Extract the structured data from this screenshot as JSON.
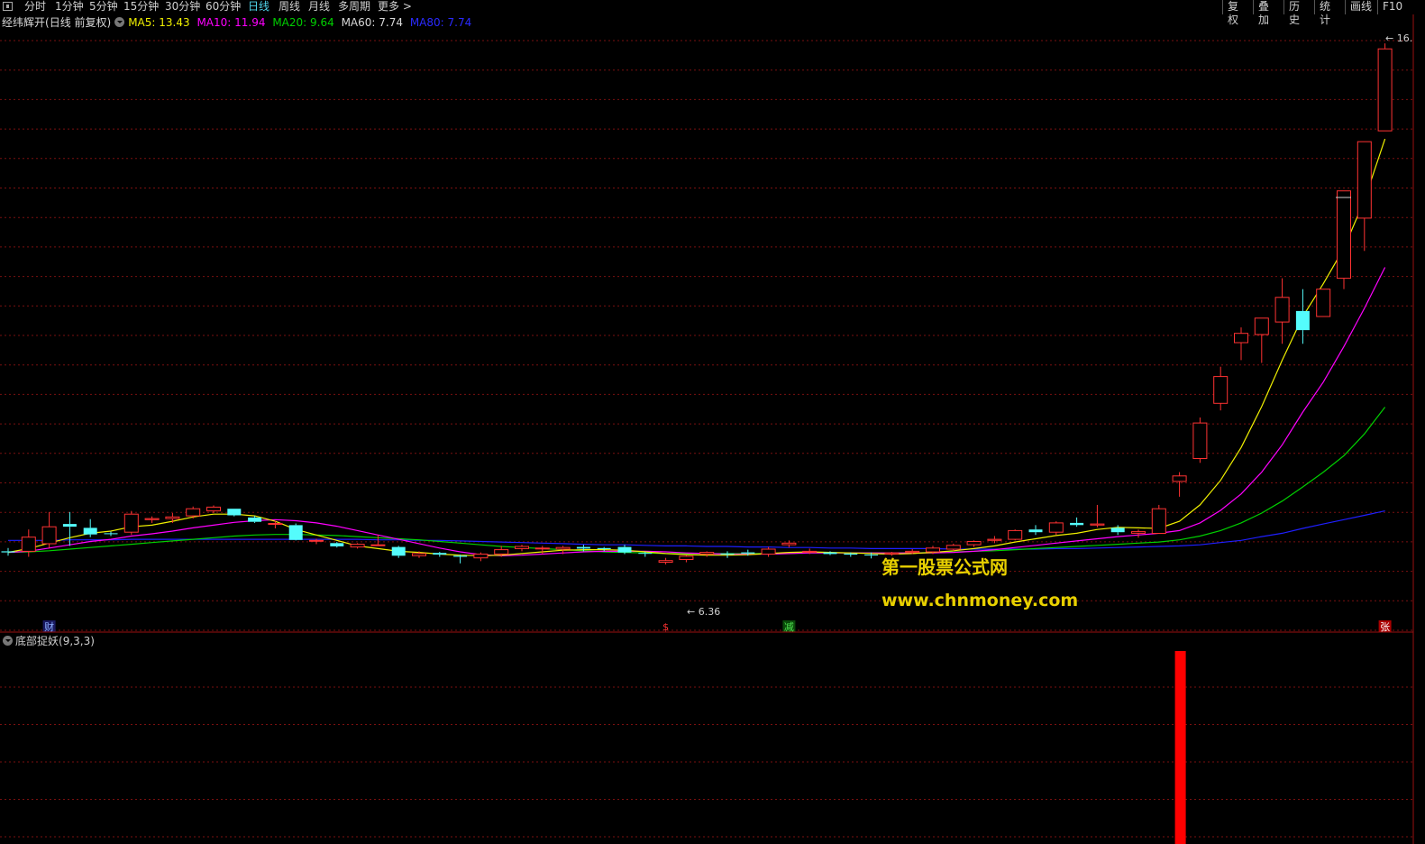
{
  "toolbar": {
    "periods": [
      "分时",
      "1分钟",
      "5分钟",
      "15分钟",
      "30分钟",
      "60分钟",
      "日线",
      "周线",
      "月线",
      "多周期",
      "更多 >"
    ],
    "active_period": "日线",
    "right_buttons": [
      "复权",
      "叠加",
      "历史",
      "统计",
      "画线",
      "F10"
    ]
  },
  "legend": {
    "title": "经纬辉开",
    "subtitle": "(日线 前复权)",
    "ma5": "MA5: 13.43",
    "ma10": "MA10: 11.94",
    "ma20": "MA20: 9.64",
    "ma60": "MA60: 7.74",
    "ma80": "MA80: 7.74"
  },
  "colors": {
    "up": "#ff3232",
    "down": "#54fcfc",
    "ma5": "#f0f000",
    "ma10": "#ff00ff",
    "ma20": "#00d000",
    "ma60": "#1f1fff",
    "grid": "#7a1010",
    "signal": "#ff0000",
    "watermark": "#e8d000"
  },
  "watermark": {
    "line1": "第一股票公式网",
    "line2": "www.chnmoney.com"
  },
  "annotations": {
    "high_label": "16.",
    "low_label": "6.36"
  },
  "markers": [
    {
      "label": "财",
      "color": "#8fb0ff",
      "bg": "#1a1a60",
      "index": 2
    },
    {
      "label": "$",
      "color": "#ff3232",
      "bg": "",
      "index": 32
    },
    {
      "label": "减",
      "color": "#50e050",
      "bg": "#0a4a0a",
      "index": 38
    },
    {
      "label": "张",
      "color": "#ffffff",
      "bg": "#aa0000",
      "index": 67
    }
  ],
  "indicator": {
    "name": "底部捉妖",
    "params": "(9,3,3)"
  },
  "chart_data": {
    "type": "candlestick",
    "title": "经纬辉开 (日线 前复权)",
    "ylim": [
      6.0,
      16.5
    ],
    "candles": [
      [
        7.0,
        7.06,
        6.92,
        6.98
      ],
      [
        7.0,
        7.4,
        6.9,
        7.26
      ],
      [
        7.14,
        7.72,
        7.06,
        7.45
      ],
      [
        7.5,
        7.72,
        7.1,
        7.45
      ],
      [
        7.43,
        7.59,
        7.26,
        7.31
      ],
      [
        7.33,
        7.36,
        7.28,
        7.32
      ],
      [
        7.35,
        7.74,
        7.3,
        7.68
      ],
      [
        7.58,
        7.64,
        7.52,
        7.6
      ],
      [
        7.6,
        7.7,
        7.52,
        7.63
      ],
      [
        7.65,
        7.82,
        7.6,
        7.78
      ],
      [
        7.74,
        7.84,
        7.7,
        7.81
      ],
      [
        7.78,
        7.78,
        7.64,
        7.66
      ],
      [
        7.62,
        7.65,
        7.52,
        7.54
      ],
      [
        7.5,
        7.56,
        7.42,
        7.51
      ],
      [
        7.48,
        7.51,
        7.2,
        7.21
      ],
      [
        7.2,
        7.23,
        7.13,
        7.2
      ],
      [
        7.15,
        7.17,
        7.07,
        7.09
      ],
      [
        7.08,
        7.15,
        7.05,
        7.13
      ],
      [
        7.12,
        7.3,
        7.1,
        7.12
      ],
      [
        7.08,
        7.1,
        6.88,
        6.92
      ],
      [
        6.92,
        7.0,
        6.88,
        6.96
      ],
      [
        6.97,
        6.99,
        6.9,
        6.94
      ],
      [
        6.92,
        6.94,
        6.78,
        6.9
      ],
      [
        6.88,
        6.98,
        6.82,
        6.95
      ],
      [
        6.95,
        7.1,
        6.9,
        7.03
      ],
      [
        7.05,
        7.12,
        7.0,
        7.09
      ],
      [
        7.05,
        7.1,
        6.95,
        7.06
      ],
      [
        7.04,
        7.1,
        6.95,
        7.07
      ],
      [
        7.08,
        7.12,
        7.0,
        7.05
      ],
      [
        7.06,
        7.08,
        7.0,
        7.04
      ],
      [
        7.08,
        7.12,
        6.95,
        6.98
      ],
      [
        6.97,
        6.99,
        6.9,
        6.96
      ],
      [
        6.8,
        6.88,
        6.76,
        6.83
      ],
      [
        6.85,
        6.93,
        6.8,
        6.91
      ],
      [
        6.95,
        7.0,
        6.9,
        6.98
      ],
      [
        6.96,
        7.0,
        6.88,
        6.95
      ],
      [
        6.98,
        7.03,
        6.92,
        6.96
      ],
      [
        6.95,
        7.08,
        6.9,
        7.04
      ],
      [
        7.12,
        7.2,
        7.07,
        7.15
      ],
      [
        7.0,
        7.05,
        6.95,
        7.0
      ],
      [
        6.98,
        7.0,
        6.93,
        6.95
      ],
      [
        6.96,
        6.98,
        6.9,
        6.94
      ],
      [
        6.94,
        6.98,
        6.87,
        6.93
      ],
      [
        6.95,
        6.99,
        6.92,
        6.97
      ],
      [
        6.98,
        7.04,
        6.95,
        7.0
      ],
      [
        6.99,
        7.1,
        6.95,
        7.06
      ],
      [
        7.04,
        7.14,
        7.0,
        7.11
      ],
      [
        7.12,
        7.2,
        7.08,
        7.18
      ],
      [
        7.2,
        7.28,
        7.15,
        7.22
      ],
      [
        7.22,
        7.4,
        7.2,
        7.38
      ],
      [
        7.4,
        7.48,
        7.3,
        7.35
      ],
      [
        7.35,
        7.55,
        7.3,
        7.52
      ],
      [
        7.52,
        7.62,
        7.45,
        7.48
      ],
      [
        7.48,
        7.85,
        7.44,
        7.5
      ],
      [
        7.43,
        7.48,
        7.3,
        7.35
      ],
      [
        7.33,
        7.4,
        7.25,
        7.36
      ],
      [
        7.33,
        7.85,
        7.32,
        7.78
      ],
      [
        8.28,
        8.45,
        8.0,
        8.38
      ],
      [
        8.7,
        9.45,
        8.62,
        9.35
      ],
      [
        9.71,
        10.38,
        9.58,
        10.2
      ],
      [
        10.82,
        11.1,
        10.5,
        10.99
      ],
      [
        10.97,
        11.2,
        10.45,
        11.27
      ],
      [
        11.2,
        12.0,
        10.8,
        11.65
      ],
      [
        11.4,
        11.8,
        10.8,
        11.05
      ],
      [
        11.3,
        11.8,
        11.3,
        11.8
      ],
      [
        12.0,
        13.2,
        11.8,
        13.6
      ],
      [
        13.1,
        14.2,
        12.5,
        14.5
      ],
      [
        14.7,
        16.3,
        14.7,
        16.2
      ]
    ],
    "ma5": [
      6.98,
      7.05,
      7.15,
      7.25,
      7.33,
      7.37,
      7.45,
      7.48,
      7.55,
      7.63,
      7.68,
      7.68,
      7.65,
      7.55,
      7.4,
      7.3,
      7.2,
      7.1,
      7.05,
      7.0,
      6.98,
      6.95,
      6.93,
      6.92,
      6.93,
      6.96,
      6.99,
      7.02,
      7.03,
      7.03,
      7.02,
      6.99,
      6.96,
      6.94,
      6.93,
      6.93,
      6.94,
      6.96,
      6.98,
      6.99,
      6.98,
      6.97,
      6.96,
      6.95,
      6.96,
      6.98,
      7.01,
      7.05,
      7.1,
      7.17,
      7.23,
      7.29,
      7.33,
      7.4,
      7.44,
      7.43,
      7.42,
      7.55,
      7.85,
      8.3,
      8.9,
      9.65,
      10.5,
      11.3,
      11.9,
      12.55,
      13.43,
      14.55
    ],
    "ma10": [
      6.98,
      7.0,
      7.06,
      7.12,
      7.18,
      7.22,
      7.28,
      7.32,
      7.37,
      7.43,
      7.48,
      7.53,
      7.56,
      7.58,
      7.56,
      7.52,
      7.46,
      7.38,
      7.3,
      7.22,
      7.14,
      7.06,
      6.99,
      6.94,
      6.92,
      6.93,
      6.95,
      6.97,
      6.99,
      7.0,
      7.0,
      7.0,
      6.99,
      6.97,
      6.96,
      6.95,
      6.95,
      6.95,
      6.96,
      6.97,
      6.97,
      6.97,
      6.97,
      6.97,
      6.97,
      6.97,
      6.98,
      7.0,
      7.03,
      7.07,
      7.11,
      7.15,
      7.19,
      7.23,
      7.27,
      7.3,
      7.33,
      7.38,
      7.52,
      7.75,
      8.05,
      8.45,
      8.95,
      9.55,
      10.1,
      10.75,
      11.45,
      12.2
    ],
    "ma20": [
      6.98,
      6.99,
      7.01,
      7.04,
      7.07,
      7.1,
      7.13,
      7.16,
      7.19,
      7.22,
      7.25,
      7.28,
      7.3,
      7.31,
      7.31,
      7.3,
      7.29,
      7.27,
      7.25,
      7.23,
      7.21,
      7.18,
      7.15,
      7.12,
      7.09,
      7.07,
      7.05,
      7.03,
      7.01,
      6.99,
      6.98,
      6.97,
      6.96,
      6.96,
      6.96,
      6.96,
      6.96,
      6.96,
      6.96,
      6.97,
      6.97,
      6.97,
      6.97,
      6.97,
      6.97,
      6.98,
      6.99,
      7.0,
      7.01,
      7.03,
      7.05,
      7.07,
      7.09,
      7.11,
      7.13,
      7.15,
      7.17,
      7.21,
      7.28,
      7.38,
      7.52,
      7.7,
      7.92,
      8.18,
      8.45,
      8.75,
      9.15,
      9.64
    ],
    "ma60": [
      7.2,
      7.2,
      7.2,
      7.21,
      7.21,
      7.21,
      7.22,
      7.22,
      7.22,
      7.22,
      7.22,
      7.22,
      7.22,
      7.22,
      7.22,
      7.22,
      7.22,
      7.22,
      7.21,
      7.21,
      7.2,
      7.2,
      7.19,
      7.18,
      7.17,
      7.16,
      7.15,
      7.14,
      7.13,
      7.12,
      7.12,
      7.11,
      7.1,
      7.1,
      7.09,
      7.09,
      7.08,
      7.08,
      7.07,
      7.07,
      7.06,
      7.06,
      7.05,
      7.05,
      7.05,
      7.05,
      7.04,
      7.04,
      7.04,
      7.04,
      7.04,
      7.05,
      7.05,
      7.06,
      7.07,
      7.08,
      7.09,
      7.1,
      7.12,
      7.16,
      7.2,
      7.27,
      7.33,
      7.42,
      7.5,
      7.58,
      7.66,
      7.74
    ],
    "indicator_bars": [
      {
        "index": 57,
        "value": 1
      }
    ]
  }
}
